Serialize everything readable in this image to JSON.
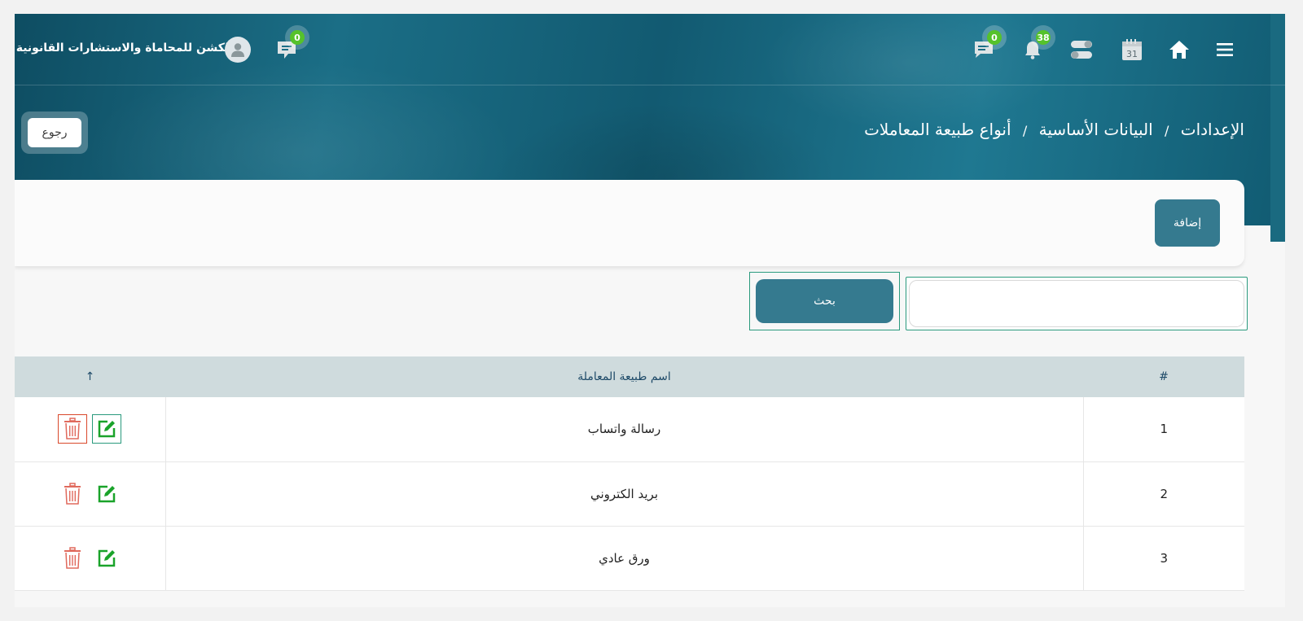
{
  "header": {
    "company_name": "الكشن للمحاماة والاستشارات القانونية",
    "calendar_day": "31",
    "messages_badge": "0",
    "notifications_badge": "38",
    "chat_badge": "0"
  },
  "breadcrumb": {
    "items": [
      "الإعدادات",
      "البيانات الأساسية",
      "أنواع طبيعة المعاملات"
    ],
    "separator": "/"
  },
  "back_button": "رجوع",
  "add_button": "إضافة",
  "search": {
    "value": "",
    "placeholder": "",
    "button_label": "بحث"
  },
  "table": {
    "columns": [
      "#",
      "اسم طبيعة المعاملة",
      "↑"
    ],
    "rows": [
      {
        "num": "1",
        "name": "رسالة واتساب"
      },
      {
        "num": "2",
        "name": "بريد الكتروني"
      },
      {
        "num": "3",
        "name": "ورق عادي"
      }
    ]
  },
  "colors": {
    "primary": "#357a8f",
    "header_bg": "#1b6e86",
    "edit_icon": "#1aa32a",
    "delete_icon": "#e06a5d",
    "badge": "#55c22b"
  },
  "icons": [
    "menu-icon",
    "home-icon",
    "calendar-icon",
    "toggle-icon",
    "bell-icon",
    "message-icon",
    "avatar-icon",
    "chat-icon",
    "sort-arrow-icon",
    "edit-icon",
    "trash-icon"
  ]
}
